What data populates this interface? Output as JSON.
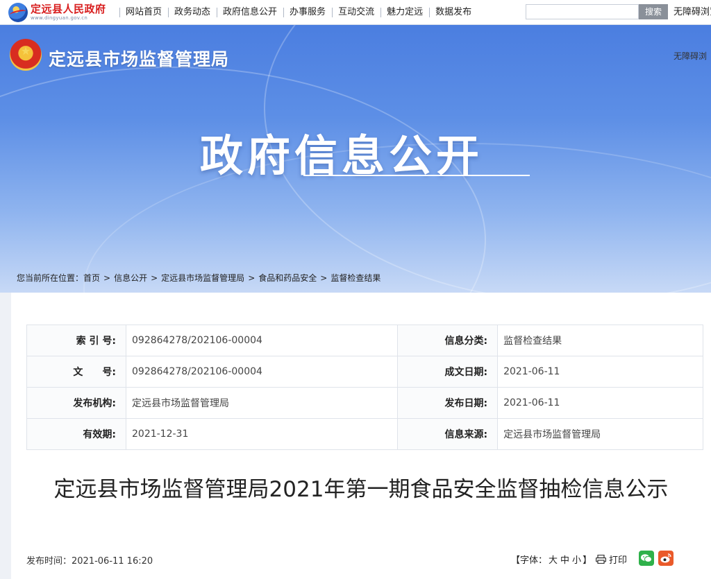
{
  "topbar": {
    "logo_title": "定远县人民政府",
    "logo_sub": "www.dingyuan.gov.cn",
    "nav": [
      "网站首页",
      "政务动态",
      "政府信息公开",
      "办事服务",
      "互动交流",
      "魅力定远",
      "数据发布"
    ],
    "search_placeholder": "",
    "search_button": "搜索",
    "accessibility": "无障碍浏览"
  },
  "banner": {
    "bureau_name": "定远县市场监督管理局",
    "accessibility": "无障碍浏",
    "big_title": "政府信息公开"
  },
  "breadcrumb": {
    "prefix": "您当前所在位置：",
    "items": [
      "首页",
      "信息公开",
      "定远县市场监督管理局",
      "食品和药品安全",
      "监督检查结果"
    ],
    "separator": ">"
  },
  "meta": {
    "rows": [
      {
        "k1": "索 引 号:",
        "v1": "092864278/202106-00004",
        "k2": "信息分类:",
        "v2": "监督检查结果"
      },
      {
        "k1": "文　　号:",
        "v1": "092864278/202106-00004",
        "k2": "成文日期:",
        "v2": "2021-06-11"
      },
      {
        "k1": "发布机构:",
        "v1": "定远县市场监督管理局",
        "k2": "发布日期:",
        "v2": "2021-06-11"
      },
      {
        "k1": "有效期:",
        "v1": "2021-12-31",
        "k2": "信息来源:",
        "v2": "定远县市场监督管理局"
      }
    ]
  },
  "article": {
    "title": "定远县市场监督管理局2021年第一期食品安全监督抽检信息公示",
    "pub_time": "发布时间：2021-06-11 16:20",
    "font_label": "【字体：",
    "font_large": "大",
    "font_medium": "中",
    "font_small": "小",
    "font_close": "】",
    "print": "打印"
  },
  "colors": {
    "banner_top": "#4b7ee0",
    "logo_red": "#d81e1e",
    "wechat": "#2fb14a",
    "weibo": "#ea5a2a"
  }
}
